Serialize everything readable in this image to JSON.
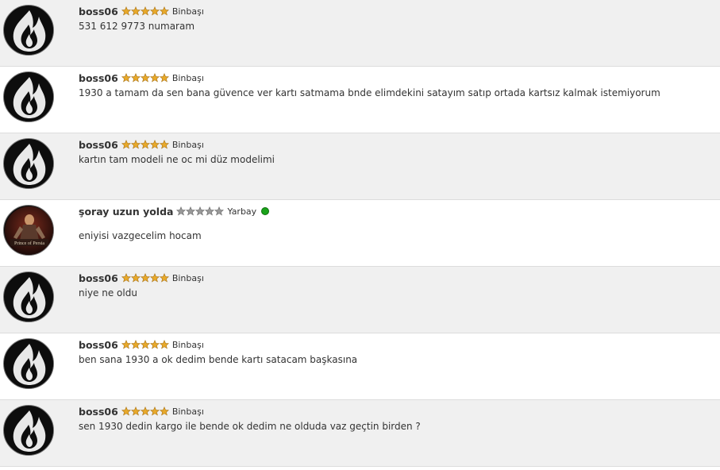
{
  "colors": {
    "row_shaded": "#f0f0f0",
    "row_plain": "#ffffff",
    "star_gold": "#e8a92a",
    "star_gray": "#999999",
    "online": "#1aa31a"
  },
  "messages": [
    {
      "username": "boss06",
      "stars": 5,
      "star_color": "gold",
      "rank": "Binbaşı",
      "online": false,
      "avatar": "flame-avatar",
      "text": "531 612 9773 numaram"
    },
    {
      "username": "boss06",
      "stars": 5,
      "star_color": "gold",
      "rank": "Binbaşı",
      "online": false,
      "avatar": "flame-avatar",
      "text": "1930 a tamam da sen bana güvence ver kartı satmama bnde elimdekini satayım satıp ortada kartsız kalmak istemiyorum"
    },
    {
      "username": "boss06",
      "stars": 5,
      "star_color": "gold",
      "rank": "Binbaşı",
      "online": false,
      "avatar": "flame-avatar",
      "text": "kartın tam modeli ne oc mi düz modelimi"
    },
    {
      "username": "şoray uzun yolda",
      "stars": 5,
      "star_color": "gray",
      "rank": "Yarbay",
      "online": true,
      "avatar": "prince-of-persia-avatar",
      "text": "eniyisi vazgecelim hocam"
    },
    {
      "username": "boss06",
      "stars": 5,
      "star_color": "gold",
      "rank": "Binbaşı",
      "online": false,
      "avatar": "flame-avatar",
      "text": "niye ne oldu"
    },
    {
      "username": "boss06",
      "stars": 5,
      "star_color": "gold",
      "rank": "Binbaşı",
      "online": false,
      "avatar": "flame-avatar",
      "text": "ben sana 1930 a ok dedim bende kartı satacam başkasına"
    },
    {
      "username": "boss06",
      "stars": 5,
      "star_color": "gold",
      "rank": "Binbaşı",
      "online": false,
      "avatar": "flame-avatar",
      "text": "sen 1930 dedin kargo ile bende ok dedim ne olduda vaz geçtin birden ?"
    }
  ]
}
